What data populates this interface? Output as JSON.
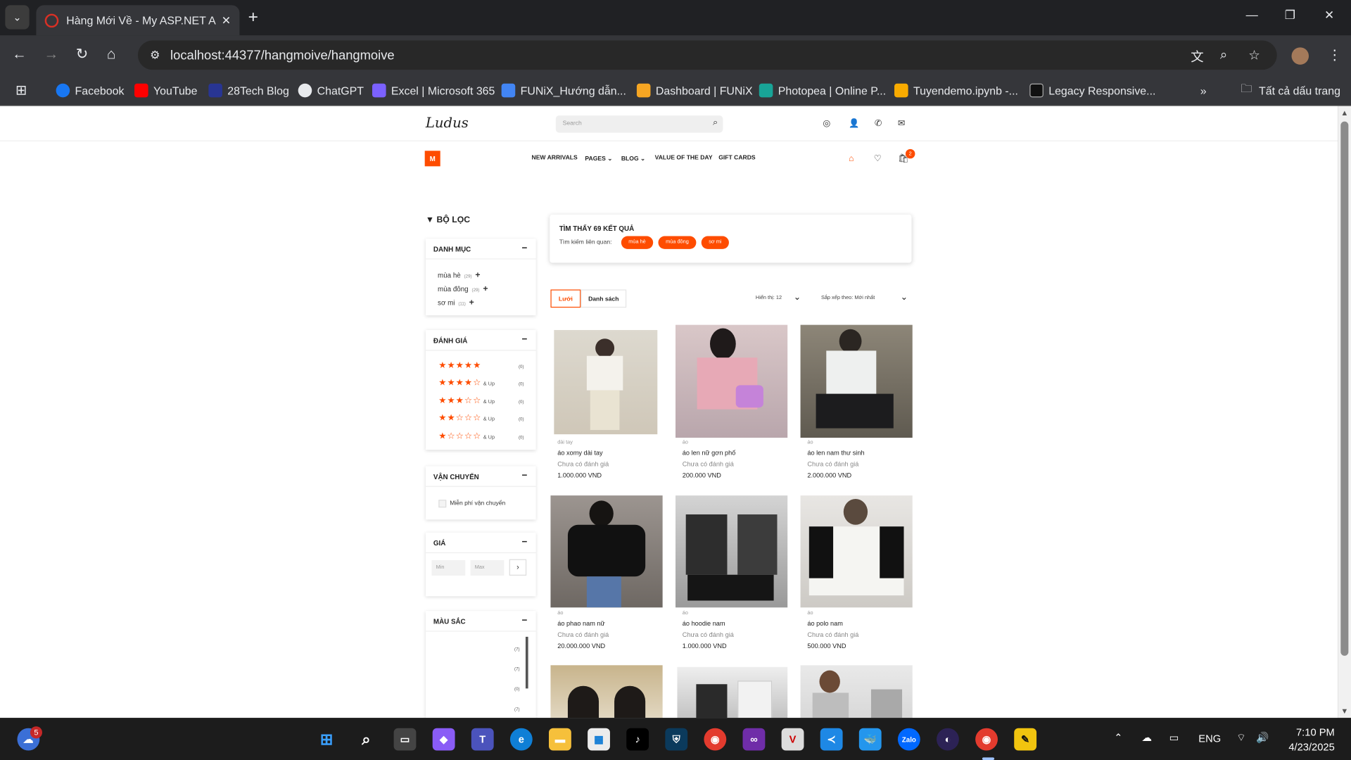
{
  "browser": {
    "tab_title": "Hàng Mới Về - My ASP.NET Ap",
    "url": "localhost:44377/hangmoive/hangmoive",
    "bookmarks": [
      "Facebook",
      "YouTube",
      "28Tech Blog",
      "ChatGPT",
      "Excel | Microsoft 365",
      "FUNiX_Hướng dẫn...",
      "Dashboard | FUNiX",
      "Photopea | Online P...",
      "Tuyendemo.ipynb -...",
      "Legacy Responsive..."
    ],
    "all_bookmarks": "Tất cả dấu trang"
  },
  "site": {
    "logo": "Ludus",
    "search_placeholder": "Search",
    "brand_letter": "M",
    "menu": [
      "NEW ARRIVALS",
      "PAGES ⌄",
      "BLOG ⌄",
      "VALUE OF THE DAY",
      "GIFT CARDS"
    ],
    "cart_count": "2"
  },
  "filters": {
    "title": "BỘ LỌC",
    "category": {
      "title": "DANH MỤC",
      "items": [
        {
          "label": "mùa hè",
          "count": "(29)"
        },
        {
          "label": "mùa đông",
          "count": "(29)"
        },
        {
          "label": "sơ mi",
          "count": "(11)"
        }
      ]
    },
    "rating": {
      "title": "ĐÁNH GIÁ",
      "rows": [
        {
          "stars": "★★★★★",
          "suffix": "",
          "count": "(0)"
        },
        {
          "stars": "★★★★☆",
          "suffix": "& Up",
          "count": "(0)"
        },
        {
          "stars": "★★★☆☆",
          "suffix": "& Up",
          "count": "(0)"
        },
        {
          "stars": "★★☆☆☆",
          "suffix": "& Up",
          "count": "(0)"
        },
        {
          "stars": "★☆☆☆☆",
          "suffix": "& Up",
          "count": "(0)"
        }
      ]
    },
    "shipping": {
      "title": "VẬN CHUYỂN",
      "option": "Miễn phí vận chuyển"
    },
    "price": {
      "title": "GIÁ",
      "min": "Min",
      "max": "Max"
    },
    "color": {
      "title": "MÀU SẮC",
      "counts": [
        "(7)",
        "(7)",
        "(0)",
        "(7)"
      ]
    }
  },
  "results": {
    "title": "TÌM THẤY 69 KẾT QUẢ",
    "related_label": "Tìm kiếm liên quan:",
    "tags": [
      "mùa hè",
      "mùa đông",
      "sơ mi"
    ],
    "view_grid": "Lưới",
    "view_list": "Danh sách",
    "show": "Hiển thị: 12",
    "sort": "Sắp xếp theo: Mới nhất"
  },
  "products": [
    {
      "category": "dài tay",
      "name": "áo xomy dài tay",
      "rating": "Chưa có đánh giá",
      "price": "1.000.000 VND"
    },
    {
      "category": "áo",
      "name": "áo len nữ gơn phố",
      "rating": "Chưa có đánh giá",
      "price": "200.000 VND"
    },
    {
      "category": "áo",
      "name": "áo len nam thư sinh",
      "rating": "Chưa có đánh giá",
      "price": "2.000.000 VND"
    },
    {
      "category": "áo",
      "name": "áo phao nam nữ",
      "rating": "Chưa có đánh giá",
      "price": "20.000.000 VND"
    },
    {
      "category": "áo",
      "name": "áo hoodie nam",
      "rating": "Chưa có đánh giá",
      "price": "1.000.000 VND"
    },
    {
      "category": "áo",
      "name": "áo polo nam",
      "rating": "Chưa có đánh giá",
      "price": "500.000 VND"
    }
  ],
  "colors": {
    "accent": "#fe4c00",
    "chrome": "#35363a"
  },
  "taskbar": {
    "weather_badge": "5",
    "lang": "ENG",
    "time": "7:10 PM",
    "date": "4/23/2025"
  }
}
